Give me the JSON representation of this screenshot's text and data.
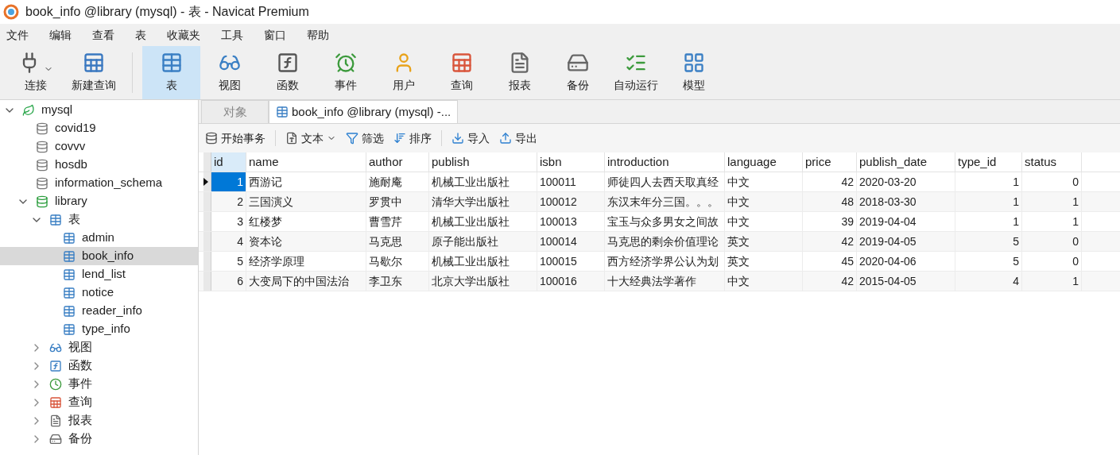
{
  "window": {
    "title": "book_info @library (mysql) - 表 - Navicat Premium"
  },
  "menu": [
    "文件",
    "编辑",
    "查看",
    "表",
    "收藏夹",
    "工具",
    "窗口",
    "帮助"
  ],
  "toolbar": [
    {
      "kind": "connect",
      "label": "连接",
      "selected": false,
      "dropdown": true
    },
    {
      "kind": "new-query",
      "label": "新建查询",
      "selected": false,
      "dropdown": false
    },
    {
      "kind": "table",
      "label": "表",
      "selected": true,
      "dropdown": false
    },
    {
      "kind": "view",
      "label": "视图",
      "selected": false,
      "dropdown": false
    },
    {
      "kind": "function",
      "label": "函数",
      "selected": false,
      "dropdown": false
    },
    {
      "kind": "event",
      "label": "事件",
      "selected": false,
      "dropdown": false
    },
    {
      "kind": "user",
      "label": "用户",
      "selected": false,
      "dropdown": false
    },
    {
      "kind": "query",
      "label": "查询",
      "selected": false,
      "dropdown": false
    },
    {
      "kind": "report",
      "label": "报表",
      "selected": false,
      "dropdown": false
    },
    {
      "kind": "backup",
      "label": "备份",
      "selected": false,
      "dropdown": false
    },
    {
      "kind": "schedule",
      "label": "自动运行",
      "selected": false,
      "dropdown": false
    },
    {
      "kind": "model",
      "label": "模型",
      "selected": false,
      "dropdown": false
    }
  ],
  "sidebar": {
    "tree": [
      {
        "kind": "connection",
        "label": "mysql",
        "expanded": true,
        "selected": false,
        "children": [
          {
            "kind": "database",
            "label": "covid19",
            "selected": false
          },
          {
            "kind": "database",
            "label": "covvv",
            "selected": false
          },
          {
            "kind": "database",
            "label": "hosdb",
            "selected": false
          },
          {
            "kind": "database",
            "label": "information_schema",
            "selected": false
          },
          {
            "kind": "database-open",
            "label": "library",
            "expanded": true,
            "selected": false,
            "children": [
              {
                "kind": "table",
                "label": "表",
                "expanded": true,
                "selected": false,
                "children": [
                  {
                    "kind": "table",
                    "label": "admin",
                    "selected": false
                  },
                  {
                    "kind": "table",
                    "label": "book_info",
                    "selected": true
                  },
                  {
                    "kind": "table",
                    "label": "lend_list",
                    "selected": false
                  },
                  {
                    "kind": "table",
                    "label": "notice",
                    "selected": false
                  },
                  {
                    "kind": "table",
                    "label": "reader_info",
                    "selected": false
                  },
                  {
                    "kind": "table",
                    "label": "type_info",
                    "selected": false
                  }
                ]
              },
              {
                "kind": "view",
                "label": "视图",
                "expanded": false,
                "selected": false
              },
              {
                "kind": "function",
                "label": "函数",
                "expanded": false,
                "selected": false
              },
              {
                "kind": "event",
                "label": "事件",
                "expanded": false,
                "selected": false
              },
              {
                "kind": "query",
                "label": "查询",
                "expanded": false,
                "selected": false
              },
              {
                "kind": "report",
                "label": "报表",
                "expanded": false,
                "selected": false
              },
              {
                "kind": "backup",
                "label": "备份",
                "expanded": false,
                "selected": false
              }
            ]
          }
        ]
      }
    ]
  },
  "tabs": [
    {
      "kind": "objects",
      "label": "对象",
      "selected": false
    },
    {
      "kind": "table",
      "label": "book_info @library (mysql) -...",
      "selected": true
    }
  ],
  "actions": [
    {
      "kind": "transaction",
      "label": "开始事务",
      "dropdown": false
    },
    {
      "kind": "text",
      "label": "文本",
      "dropdown": true
    },
    {
      "kind": "filter",
      "label": "筛选",
      "dropdown": false
    },
    {
      "kind": "sort",
      "label": "排序",
      "dropdown": false
    },
    {
      "kind": "import",
      "label": "导入",
      "dropdown": false
    },
    {
      "kind": "export",
      "label": "导出",
      "dropdown": false
    }
  ],
  "table": {
    "columns": [
      "id",
      "name",
      "author",
      "publish",
      "isbn",
      "introduction",
      "language",
      "price",
      "publish_date",
      "type_id",
      "status"
    ],
    "rows": [
      {
        "selected": true,
        "cells": [
          "1",
          "西游记",
          "施耐庵",
          "机械工业出版社",
          "100011",
          "师徒四人去西天取真经",
          "中文",
          "42",
          "2020-03-20",
          "1",
          "0"
        ]
      },
      {
        "selected": false,
        "cells": [
          "2",
          "三国演义",
          "罗贯中",
          "清华大学出版社",
          "100012",
          "东汉末年分三国。。。",
          "中文",
          "48",
          "2018-03-30",
          "1",
          "1"
        ]
      },
      {
        "selected": false,
        "cells": [
          "3",
          "红楼梦",
          "曹雪芹",
          "机械工业出版社",
          "100013",
          "宝玉与众多男女之间故",
          "中文",
          "39",
          "2019-04-04",
          "1",
          "1"
        ]
      },
      {
        "selected": false,
        "cells": [
          "4",
          "资本论",
          "马克思",
          "原子能出版社",
          "100014",
          "马克思的剩余价值理论",
          "英文",
          "42",
          "2019-04-05",
          "5",
          "0"
        ]
      },
      {
        "selected": false,
        "cells": [
          "5",
          "经济学原理",
          "马歇尔",
          "机械工业出版社",
          "100015",
          "西方经济学界公认为划",
          "英文",
          "45",
          "2020-04-06",
          "5",
          "0"
        ]
      },
      {
        "selected": false,
        "cells": [
          "6",
          "大变局下的中国法治",
          "李卫东",
          "北京大学出版社",
          "100016",
          "十大经典法学著作",
          "中文",
          "42",
          "2015-04-05",
          "4",
          "1"
        ]
      }
    ]
  }
}
